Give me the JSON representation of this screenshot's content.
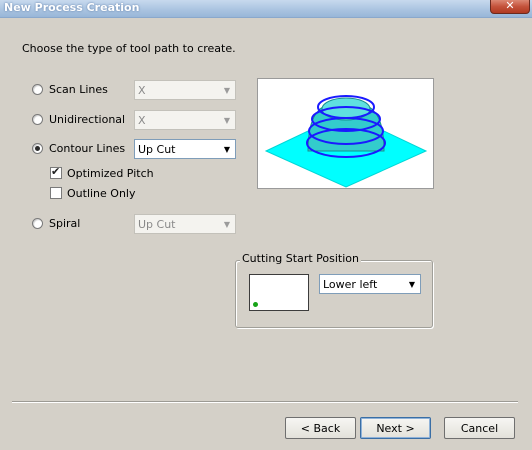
{
  "window": {
    "title": "New Process Creation",
    "close_icon": "close-icon"
  },
  "prompt": "Choose the type of tool path to create.",
  "options": {
    "scan_lines": {
      "label": "Scan Lines",
      "checked": false,
      "combo_value": "X",
      "combo_enabled": false
    },
    "unidirectional": {
      "label": "Unidirectional",
      "checked": false,
      "combo_value": "X",
      "combo_enabled": false
    },
    "contour_lines": {
      "label": "Contour Lines",
      "checked": true,
      "combo_value": "Up Cut",
      "combo_enabled": true
    },
    "spiral": {
      "label": "Spiral",
      "checked": false,
      "combo_value": "Up Cut",
      "combo_enabled": false
    }
  },
  "checkboxes": {
    "optimized_pitch": {
      "label": "Optimized Pitch",
      "checked": true
    },
    "outline_only": {
      "label": "Outline Only",
      "checked": false
    }
  },
  "cutting_start": {
    "label": "Cutting Start Position",
    "value": "Lower left"
  },
  "buttons": {
    "back": "< Back",
    "next": "Next >",
    "cancel": "Cancel"
  },
  "colors": {
    "plane": "#00ffff",
    "dome": "#33cccc",
    "contour": "#1a1aff"
  }
}
